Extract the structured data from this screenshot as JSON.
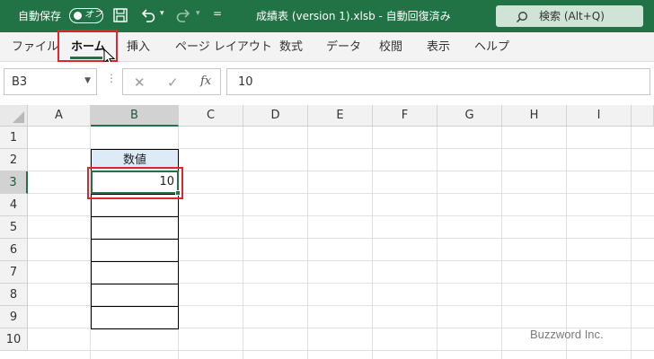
{
  "titlebar": {
    "autosave_label": "自動保存",
    "autosave_state": "オフ",
    "document_title": "成績表 (version 1).xlsb  -  自動回復済み",
    "qat_more": "=",
    "search_placeholder": "検索 (Alt+Q)",
    "colors": {
      "background": "#217346",
      "search_box": "#cfe3d7"
    },
    "icons": [
      "save-icon",
      "undo-icon",
      "redo-icon",
      "search-icon"
    ]
  },
  "ribbon": {
    "tabs": [
      "ファイル",
      "ホーム",
      "挿入",
      "ページ レイアウト",
      "数式",
      "データ",
      "校閲",
      "表示",
      "ヘルプ"
    ],
    "active_tab": "ホーム",
    "highlight_color": "#e0262a"
  },
  "formula_bar": {
    "name_box": "B3",
    "cancel_symbol": "✕",
    "enter_symbol": "✓",
    "fx_symbol": "fx",
    "formula_value": "10"
  },
  "grid": {
    "columns": [
      "A",
      "B",
      "C",
      "D",
      "E",
      "F",
      "G",
      "H",
      "I"
    ],
    "rows": [
      "1",
      "2",
      "3",
      "4",
      "5",
      "6",
      "7",
      "8",
      "9",
      "10"
    ],
    "selected_column": "B",
    "selected_row": "3",
    "selected_cell": "B3",
    "cells": {
      "B2": "数値",
      "B3": "10"
    },
    "header_cell_fill": "#ddebf7",
    "accent_color": "#217346"
  },
  "watermark": "Buzzword Inc."
}
